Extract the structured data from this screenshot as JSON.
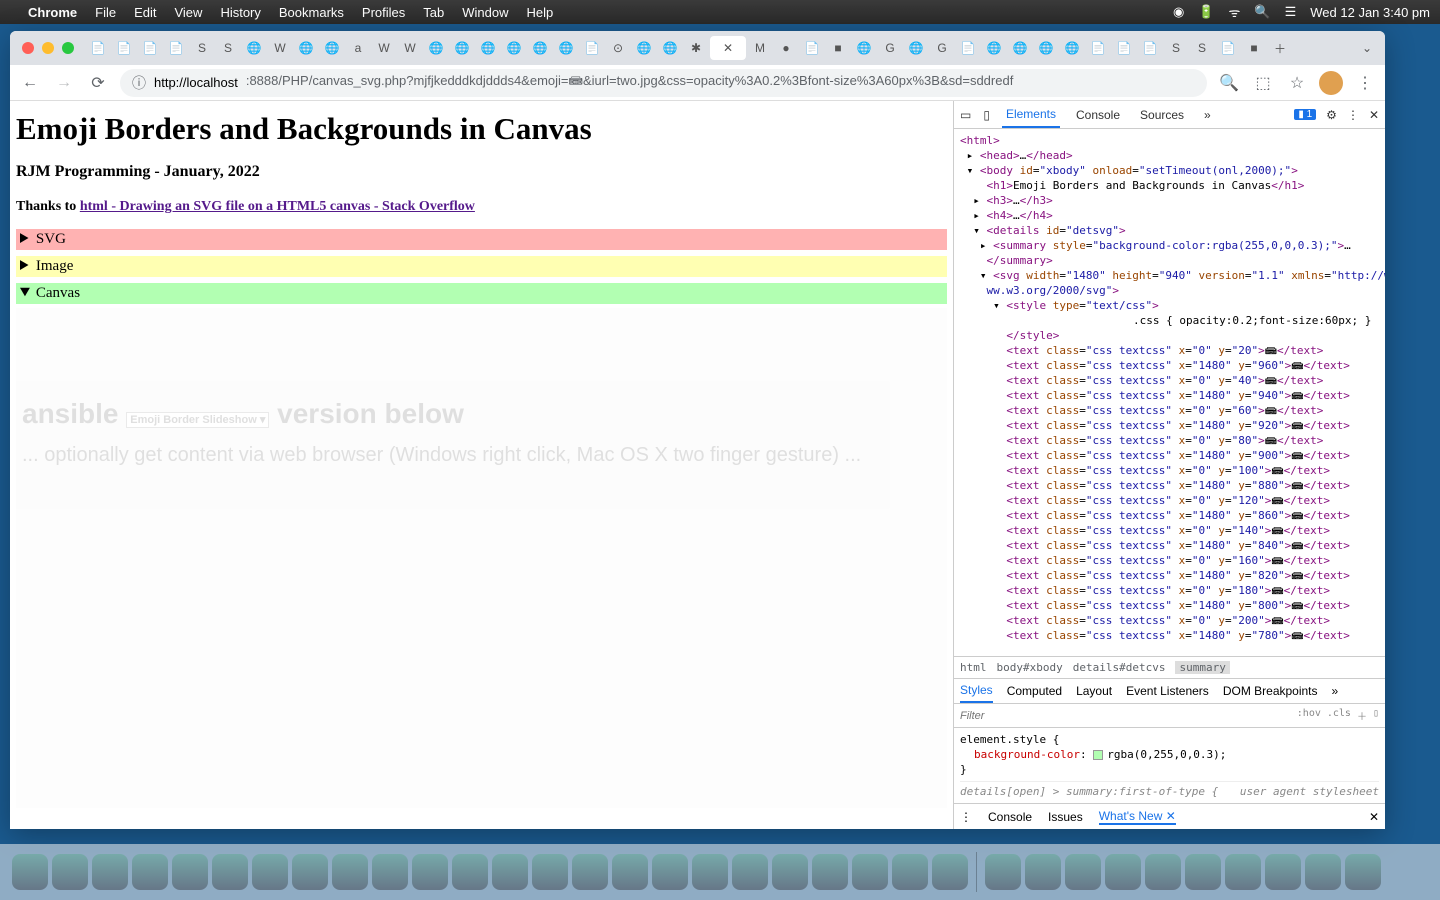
{
  "menubar": {
    "app": "Chrome",
    "items": [
      "File",
      "Edit",
      "View",
      "History",
      "Bookmarks",
      "Profiles",
      "Tab",
      "Window",
      "Help"
    ],
    "clock": "Wed 12 Jan  3:40 pm"
  },
  "chrome": {
    "url_prefix": "http://localhost",
    "url_rest": ":8888/PHP/canvas_svg.php?mjfjkedddkdjddds4&emoji=📾&iurl=two.jpg&css=opacity%3A0.2%3Bfont-size%3A60px%3B&sd=sddredf"
  },
  "page": {
    "title": "Emoji Borders and Backgrounds in Canvas",
    "subtitle": "RJM Programming - January, 2022",
    "thanks_prefix": "Thanks to ",
    "thanks_link": "html - Drawing an SVG file on a HTML5 canvas - Stack Overflow",
    "svg_label": "SVG",
    "image_label": "Image",
    "canvas_label": "Canvas",
    "canvas_body": {
      "ansible": "ansible",
      "slideshow": "Emoji Border Slideshow ▾",
      "version": "version below",
      "instructions": "... optionally get content via web browser (Windows right click, Mac OS X two finger gesture) ..."
    }
  },
  "devtools": {
    "tabs": [
      "Elements",
      "Console",
      "Sources"
    ],
    "more": "»",
    "badge": "1",
    "html_open": "<html>",
    "head": "<head>…</head>",
    "body": "<body id=\"xbody\" onload=\"setTimeout(onl,2000);\">",
    "h1": "Emoji Borders and Backgrounds in Canvas",
    "h3": "<h3>…</h3>",
    "h4": "<h4>…</h4>",
    "details": "<details id=\"detsvg\">",
    "summary": "<summary style=\"background-color:rgba(255,0,0,0.3);\">…</summary>",
    "svg": "<svg width=\"1480\" height=\"940\" version=\"1.1\" xmlns=\"http://www.w3.org/2000/svg\">",
    "style": "<style type=\"text/css\">",
    "css_rule": ".css { opacity:0.2;font-size:60px; }",
    "style_close": "</style>",
    "text_rows": [
      {
        "x": "0",
        "y": "20"
      },
      {
        "x": "1480",
        "y": "960"
      },
      {
        "x": "0",
        "y": "40"
      },
      {
        "x": "1480",
        "y": "940"
      },
      {
        "x": "0",
        "y": "60"
      },
      {
        "x": "1480",
        "y": "920"
      },
      {
        "x": "0",
        "y": "80"
      },
      {
        "x": "1480",
        "y": "900"
      },
      {
        "x": "0",
        "y": "100"
      },
      {
        "x": "1480",
        "y": "880"
      },
      {
        "x": "0",
        "y": "120"
      },
      {
        "x": "1480",
        "y": "860"
      },
      {
        "x": "0",
        "y": "140"
      },
      {
        "x": "1480",
        "y": "840"
      },
      {
        "x": "0",
        "y": "160"
      },
      {
        "x": "1480",
        "y": "820"
      },
      {
        "x": "0",
        "y": "180"
      },
      {
        "x": "1480",
        "y": "800"
      },
      {
        "x": "0",
        "y": "200"
      },
      {
        "x": "1480",
        "y": "780"
      }
    ],
    "breadcrumb": [
      "html",
      "body#xbody",
      "details#detcvs",
      "summary"
    ],
    "styles_tabs": [
      "Styles",
      "Computed",
      "Layout",
      "Event Listeners",
      "DOM Breakpoints"
    ],
    "filter_placeholder": "Filter",
    "hov": ":hov",
    "cls": ".cls",
    "element_style_open": "element.style {",
    "bg_prop": "background-color",
    "bg_val": "rgba(0,255,0,0.3);",
    "element_style_close": "}",
    "ua_rule": "details[open] > summary:first-of-type {",
    "ua_label": "user agent stylesheet",
    "drawer": [
      "Console",
      "Issues",
      "What's New"
    ]
  }
}
